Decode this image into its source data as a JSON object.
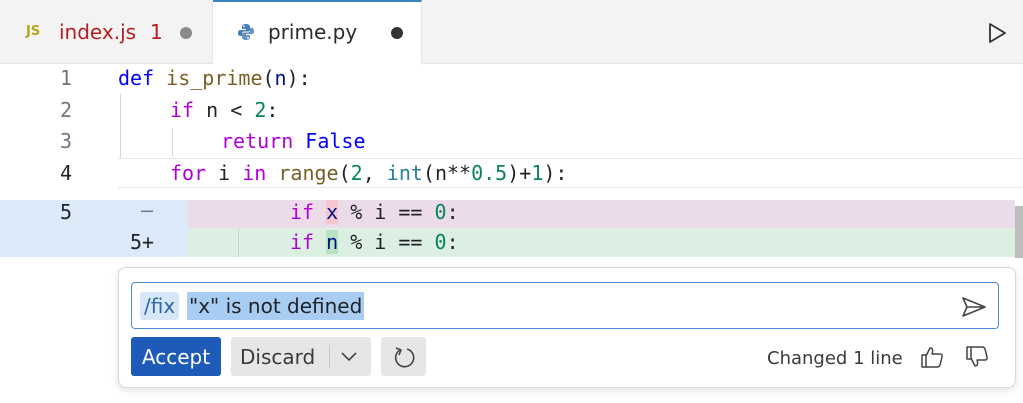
{
  "tabs": [
    {
      "icon": "JS",
      "label": "index.js",
      "count": "1",
      "modified": true
    },
    {
      "icon": "python-icon",
      "label": "prime.py",
      "modified": true,
      "active": true
    }
  ],
  "editor": {
    "line_numbers": [
      "1",
      "2",
      "3",
      "4",
      "5"
    ],
    "diff_line_number": "5+",
    "diff_removed_sign": "—",
    "lines": {
      "l1": {
        "t1": "def",
        "t2": " ",
        "t3": "is_prime",
        "t4": "(",
        "t5": "n",
        "t6": "):"
      },
      "l2": {
        "t1": "if",
        "t2": " n < ",
        "t3": "2",
        "t4": ":"
      },
      "l3": {
        "t1": "return",
        "t2": " ",
        "t3": "False"
      },
      "l4": {
        "t1": "for",
        "t2": " i ",
        "t3": "in",
        "t4": " ",
        "t5": "range",
        "t6": "(",
        "t7": "2",
        "t8": ", ",
        "t9": "int",
        "t10": "(n**",
        "t11": "0.5",
        "t12": ")+",
        "t13": "1",
        "t14": "):"
      },
      "removed": {
        "t1": "if",
        "t2": " ",
        "t3": "x",
        "t4": " % i == ",
        "t5": "0",
        "t6": ":"
      },
      "added": {
        "t1": "if",
        "t2": " ",
        "t3": "n",
        "t4": " % i == ",
        "t5": "0",
        "t6": ":"
      }
    }
  },
  "chat": {
    "command": "/fix",
    "message": "\"x\" is not defined",
    "accept_label": "Accept",
    "discard_label": "Discard",
    "status": "Changed 1 line"
  },
  "colors": {
    "accent": "#1e5bb8",
    "diff_removed": "#ecdbe9",
    "diff_added": "#dcefe3",
    "error_tab": "#b61e1e"
  }
}
